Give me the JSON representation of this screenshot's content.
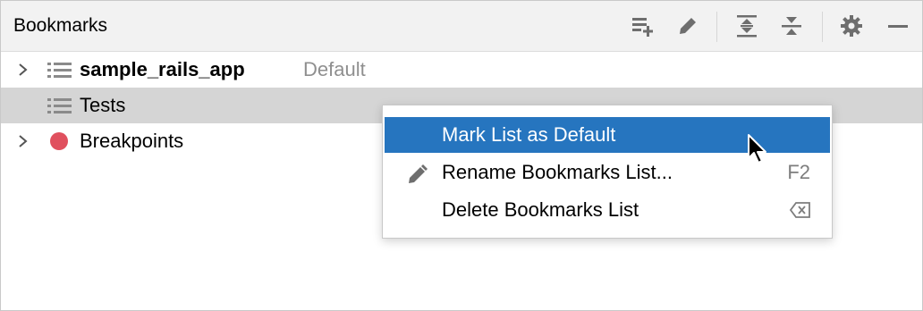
{
  "panel": {
    "title": "Bookmarks"
  },
  "toolbar_icons": [
    "add-list-icon",
    "edit-pencil-icon",
    "expand-all-icon",
    "collapse-all-icon",
    "gear-icon",
    "minimize-icon"
  ],
  "tree": {
    "rows": [
      {
        "label": "sample_rails_app",
        "hint": "Default",
        "icon": "list-icon",
        "expandable": true,
        "bold": true
      },
      {
        "label": "Tests",
        "icon": "list-icon",
        "expandable": false,
        "selected": true
      },
      {
        "label": "Breakpoints",
        "icon": "breakpoint-dot-icon",
        "expandable": true
      }
    ]
  },
  "context_menu": {
    "items": [
      {
        "label": "Mark List as Default",
        "active": true
      },
      {
        "label": "Rename Bookmarks List...",
        "shortcut": "F2",
        "icon": "pencil-icon"
      },
      {
        "label": "Delete Bookmarks List",
        "shortcut_icon": "backspace-icon"
      }
    ]
  },
  "colors": {
    "selection": "#2675bf",
    "row_selected": "#d5d5d5",
    "breakpoint": "#e0505e",
    "hint_text": "#8f8f8f"
  }
}
